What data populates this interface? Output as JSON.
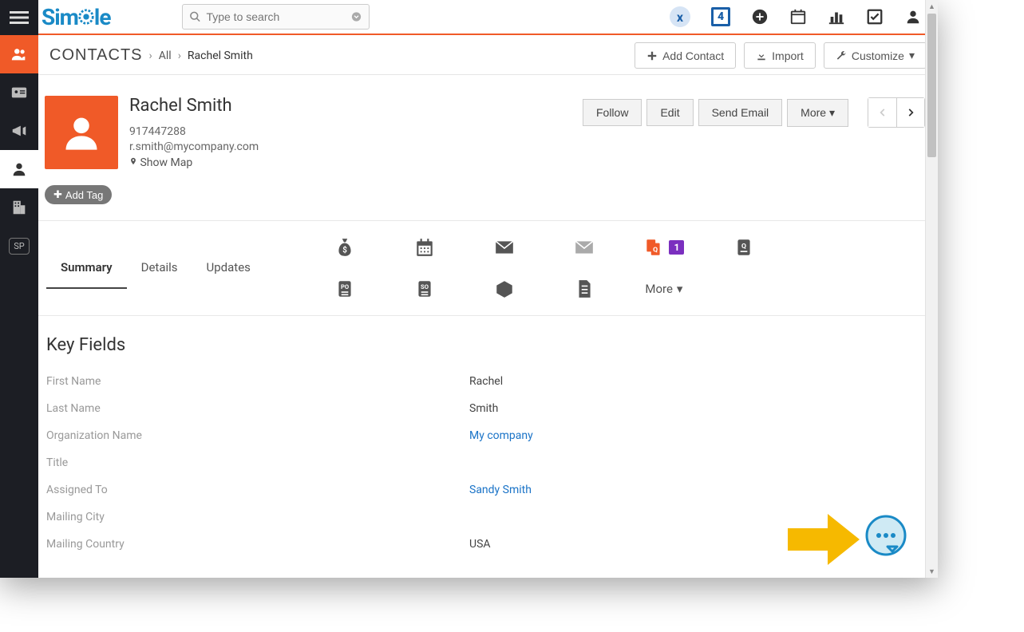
{
  "logo": "Simple",
  "search": {
    "placeholder": "Type to search"
  },
  "topbar_icons": {
    "x_badge": "x",
    "num_badge": "4"
  },
  "breadcrumb": {
    "module": "Contacts",
    "all": "All",
    "name": "Rachel Smith"
  },
  "action_buttons": {
    "add": "Add Contact",
    "import": "Import",
    "customize": "Customize"
  },
  "contact": {
    "name": "Rachel Smith",
    "phone": "917447288",
    "email": "r.smith@mycompany.com",
    "show_map": "Show Map"
  },
  "header_actions": {
    "follow": "Follow",
    "edit": "Edit",
    "send_email": "Send Email",
    "more": "More"
  },
  "add_tag": "Add Tag",
  "tabs": {
    "summary": "Summary",
    "details": "Details",
    "updates": "Updates",
    "more": "More",
    "badge1": "1"
  },
  "key_fields": {
    "heading": "Key Fields",
    "rows": [
      {
        "label": "First Name",
        "value": "Rachel",
        "link": false
      },
      {
        "label": "Last Name",
        "value": "Smith",
        "link": false
      },
      {
        "label": "Organization Name",
        "value": "My company",
        "link": true
      },
      {
        "label": "Title",
        "value": "",
        "link": false
      },
      {
        "label": "Assigned To",
        "value": "Sandy Smith",
        "link": true
      },
      {
        "label": "Mailing City",
        "value": "",
        "link": false
      },
      {
        "label": "Mailing Country",
        "value": "USA",
        "link": false
      }
    ]
  },
  "sidebar_sp": "SP"
}
